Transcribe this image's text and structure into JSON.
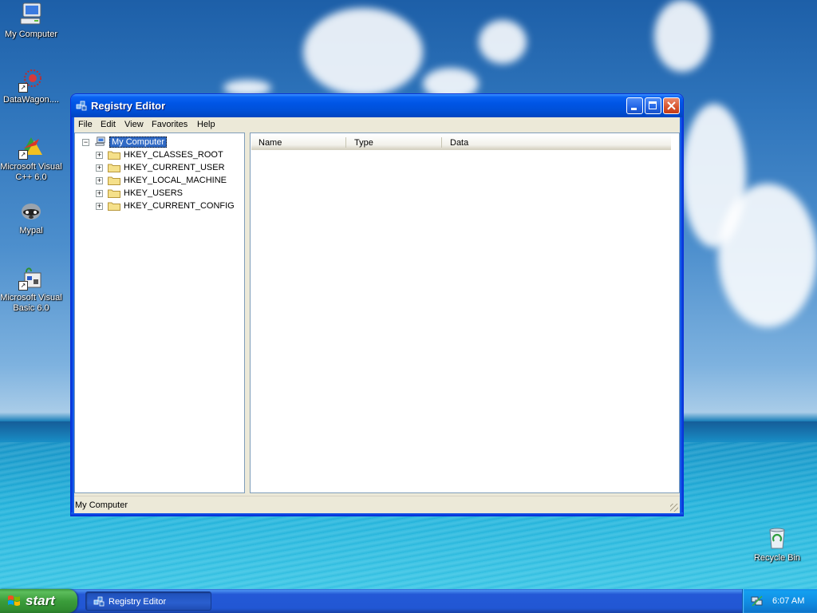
{
  "desktop": {
    "icons": [
      {
        "label": "My Computer",
        "icon": "my-computer-icon"
      },
      {
        "label": "DataWagon....",
        "icon": "datawagon-icon"
      },
      {
        "label": "Microsoft Visual C++ 6.0",
        "icon": "visual-cpp-icon"
      },
      {
        "label": "Mypal",
        "icon": "mypal-raccoon-icon"
      },
      {
        "label": "Microsoft Visual Basic 6.0",
        "icon": "visual-basic-icon"
      },
      {
        "label": "Recycle Bin",
        "icon": "recycle-bin-icon"
      }
    ]
  },
  "window": {
    "title": "Registry Editor",
    "menu": [
      "File",
      "Edit",
      "View",
      "Favorites",
      "Help"
    ],
    "tree": {
      "root": "My Computer",
      "keys": [
        "HKEY_CLASSES_ROOT",
        "HKEY_CURRENT_USER",
        "HKEY_LOCAL_MACHINE",
        "HKEY_USERS",
        "HKEY_CURRENT_CONFIG"
      ]
    },
    "list_columns": [
      "Name",
      "Type",
      "Data"
    ],
    "status": "My Computer"
  },
  "taskbar": {
    "start_label": "start",
    "task_label": "Registry Editor",
    "clock": "6:07 AM"
  },
  "colors": {
    "title_blue": "#0055e5",
    "selection": "#316ac5",
    "start_green": "#3b9d3b",
    "taskbar_blue": "#2157d4",
    "tray_blue": "#108ae0"
  }
}
